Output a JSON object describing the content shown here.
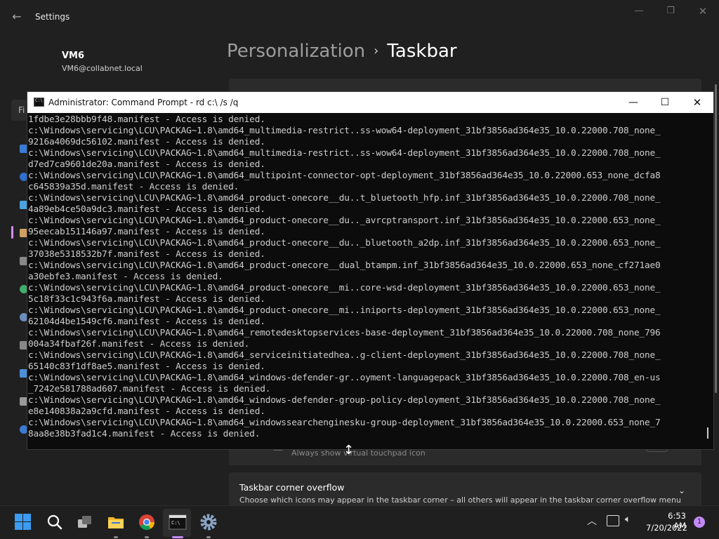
{
  "settings": {
    "app_title": "Settings",
    "user": {
      "name": "VM6",
      "email": "VM6@collabnet.local"
    },
    "breadcrumb": {
      "parent": "Personalization",
      "separator": "›",
      "current": "Taskbar"
    },
    "find_placeholder": "Fi",
    "touchpad_label": "Always show virtual touchpad icon",
    "overflow": {
      "title": "Taskbar corner overflow",
      "description": "Choose which icons may appear in the taskbar corner – all others will appear in the taskbar corner overflow menu"
    }
  },
  "cmd": {
    "title": "Administrator: Command Prompt - rd  c:\\ /s /q",
    "lines": [
      "1fdbe3e28bbb9f48.manifest - Access is denied.",
      "c:\\Windows\\servicing\\LCU\\PACKAG~1.8\\amd64_multimedia-restrict..ss-wow64-deployment_31bf3856ad364e35_10.0.22000.708_none_",
      "9216a4069dc56102.manifest - Access is denied.",
      "c:\\Windows\\servicing\\LCU\\PACKAG~1.8\\amd64_multimedia-restrict..ss-wow64-deployment_31bf3856ad364e35_10.0.22000.708_none_",
      "d7ed7ca9601de20a.manifest - Access is denied.",
      "c:\\Windows\\servicing\\LCU\\PACKAG~1.8\\amd64_multipoint-connector-opt-deployment_31bf3856ad364e35_10.0.22000.653_none_dcfa8",
      "c645839a35d.manifest - Access is denied.",
      "c:\\Windows\\servicing\\LCU\\PACKAG~1.8\\amd64_product-onecore__du..t_bluetooth_hfp.inf_31bf3856ad364e35_10.0.22000.708_none_",
      "4a89eb4ce50a9dc3.manifest - Access is denied.",
      "c:\\Windows\\servicing\\LCU\\PACKAG~1.8\\amd64_product-onecore__du.._avrcptransport.inf_31bf3856ad364e35_10.0.22000.653_none_",
      "95eecab151146a97.manifest - Access is denied.",
      "c:\\Windows\\servicing\\LCU\\PACKAG~1.8\\amd64_product-onecore__du.._bluetooth_a2dp.inf_31bf3856ad364e35_10.0.22000.653_none_",
      "37038e5318532b7f.manifest - Access is denied.",
      "c:\\Windows\\servicing\\LCU\\PACKAG~1.8\\amd64_product-onecore__dual_btampm.inf_31bf3856ad364e35_10.0.22000.653_none_cf271ae0",
      "a30ebfe3.manifest - Access is denied.",
      "c:\\Windows\\servicing\\LCU\\PACKAG~1.8\\amd64_product-onecore__mi..core-wsd-deployment_31bf3856ad364e35_10.0.22000.653_none_",
      "5c18f33c1c943f6a.manifest - Access is denied.",
      "c:\\Windows\\servicing\\LCU\\PACKAG~1.8\\amd64_product-onecore__mi..iniports-deployment_31bf3856ad364e35_10.0.22000.653_none_",
      "62104d4be1549cf6.manifest - Access is denied.",
      "c:\\Windows\\servicing\\LCU\\PACKAG~1.8\\amd64_remotedesktopservices-base-deployment_31bf3856ad364e35_10.0.22000.708_none_796",
      "004a34fbaf26f.manifest - Access is denied.",
      "c:\\Windows\\servicing\\LCU\\PACKAG~1.8\\amd64_serviceinitiatedhea..g-client-deployment_31bf3856ad364e35_10.0.22000.708_none_",
      "65140c83f1df8ae5.manifest - Access is denied.",
      "c:\\Windows\\servicing\\LCU\\PACKAG~1.8\\amd64_windows-defender-gr..oyment-languagepack_31bf3856ad364e35_10.0.22000.708_en-us",
      "_7242e581788ad607.manifest - Access is denied.",
      "c:\\Windows\\servicing\\LCU\\PACKAG~1.8\\amd64_windows-defender-group-policy-deployment_31bf3856ad364e35_10.0.22000.708_none_",
      "e8e140838a2a9cfd.manifest - Access is denied.",
      "c:\\Windows\\servicing\\LCU\\PACKAG~1.8\\amd64_windowssearchenginesku-group-deployment_31bf3856ad364e35_10.0.22000.653_none_7",
      "8aa8e38b3fad1c4.manifest - Access is denied."
    ]
  },
  "taskbar": {
    "apps": [
      {
        "name": "Start",
        "icon": "windows-start-icon"
      },
      {
        "name": "Search",
        "icon": "search-icon"
      },
      {
        "name": "Task View",
        "icon": "task-view-icon"
      },
      {
        "name": "File Explorer",
        "icon": "folder-icon"
      },
      {
        "name": "Google Chrome",
        "icon": "chrome-icon"
      },
      {
        "name": "Command Prompt",
        "icon": "terminal-icon"
      },
      {
        "name": "Settings",
        "icon": "gear-icon"
      }
    ],
    "clock": {
      "time": "6:53 AM",
      "date": "7/20/2022"
    },
    "notification_count": "1"
  },
  "colors": {
    "accent": "#c58af9",
    "start_blue": "#3c9cf3",
    "settings_bg": "#202020",
    "console_bg": "#0c0c0c"
  }
}
